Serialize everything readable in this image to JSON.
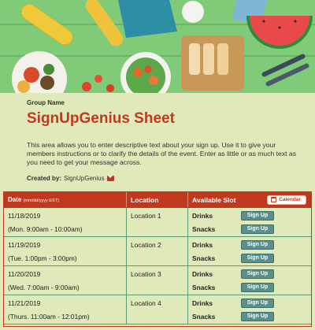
{
  "banner": {
    "alt": "Food banner image"
  },
  "header": {
    "group_name": "Group Name",
    "title": "SignUpGenius Sheet",
    "description": "This area allows you to enter descriptive text about your sign up. Use it to give your members instructions or to clarify the details of the event. Enter as little or as much text as you need to get your message across.",
    "created_by_label": "Created by:",
    "created_by_name": "SignUpGenius"
  },
  "table": {
    "col_date": "Date",
    "col_date_format": "(mm/dd/yyyy EST)",
    "col_location": "Location",
    "col_slot": "Available Slot",
    "calendar_label": "Calendar",
    "signup_label": "Sign Up",
    "rows": [
      {
        "date": "11/18/2019",
        "time": "(Mon. 9:00am - 10:00am)",
        "location": "Location 1",
        "slots": [
          "Drinks",
          "Snacks"
        ]
      },
      {
        "date": "11/19/2019",
        "time": "(Tue. 1:00pm - 3:00pm)",
        "location": "Location 2",
        "slots": [
          "Drinks",
          "Snacks"
        ]
      },
      {
        "date": "11/20/2019",
        "time": "(Wed. 7:00am - 9:00am)",
        "location": "Location 3",
        "slots": [
          "Drinks",
          "Snacks"
        ]
      },
      {
        "date": "11/21/2019",
        "time": "(Thurs. 11:00am - 12:01pm)",
        "location": "Location 4",
        "slots": [
          "Drinks",
          "Snacks"
        ]
      }
    ]
  },
  "colors": {
    "accent": "#c0391f",
    "background": "#dfe9b9",
    "button": "#5a8f8c",
    "row_border": "#5a9b74"
  }
}
